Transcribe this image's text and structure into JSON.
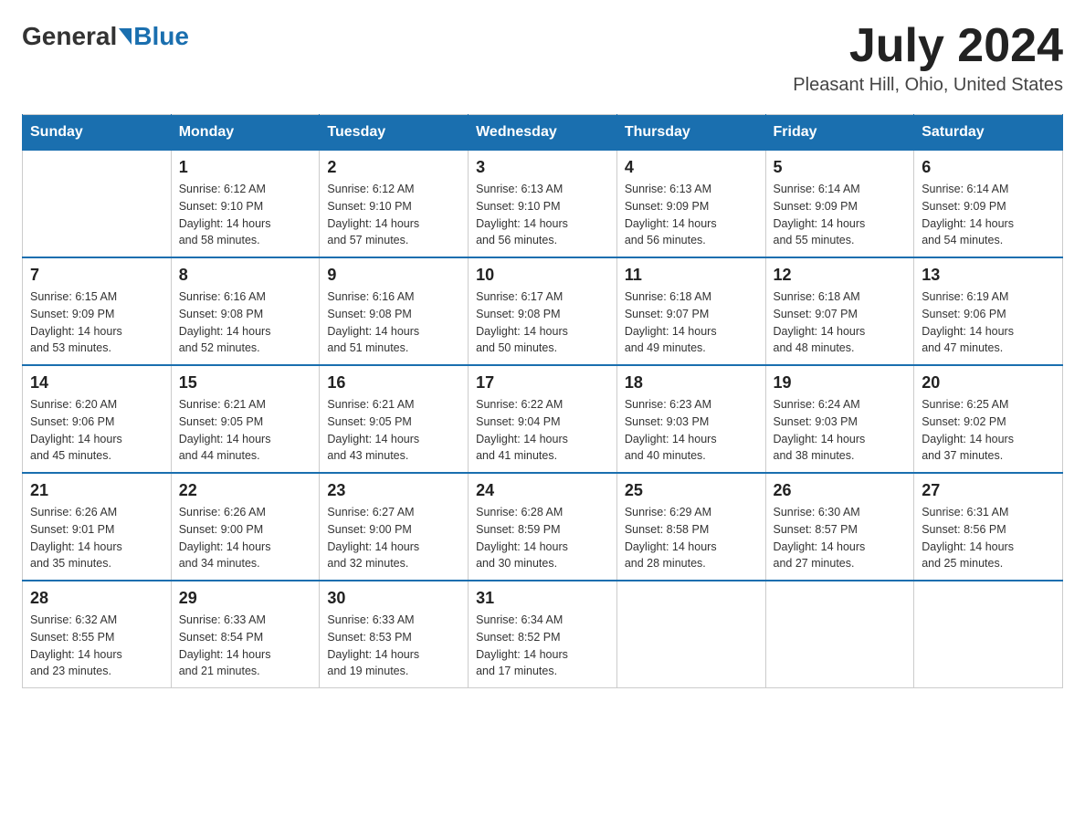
{
  "logo": {
    "general": "General",
    "blue": "Blue"
  },
  "title": "July 2024",
  "location": "Pleasant Hill, Ohio, United States",
  "days_of_week": [
    "Sunday",
    "Monday",
    "Tuesday",
    "Wednesday",
    "Thursday",
    "Friday",
    "Saturday"
  ],
  "weeks": [
    [
      {
        "day": "",
        "info": ""
      },
      {
        "day": "1",
        "info": "Sunrise: 6:12 AM\nSunset: 9:10 PM\nDaylight: 14 hours\nand 58 minutes."
      },
      {
        "day": "2",
        "info": "Sunrise: 6:12 AM\nSunset: 9:10 PM\nDaylight: 14 hours\nand 57 minutes."
      },
      {
        "day": "3",
        "info": "Sunrise: 6:13 AM\nSunset: 9:10 PM\nDaylight: 14 hours\nand 56 minutes."
      },
      {
        "day": "4",
        "info": "Sunrise: 6:13 AM\nSunset: 9:09 PM\nDaylight: 14 hours\nand 56 minutes."
      },
      {
        "day": "5",
        "info": "Sunrise: 6:14 AM\nSunset: 9:09 PM\nDaylight: 14 hours\nand 55 minutes."
      },
      {
        "day": "6",
        "info": "Sunrise: 6:14 AM\nSunset: 9:09 PM\nDaylight: 14 hours\nand 54 minutes."
      }
    ],
    [
      {
        "day": "7",
        "info": "Sunrise: 6:15 AM\nSunset: 9:09 PM\nDaylight: 14 hours\nand 53 minutes."
      },
      {
        "day": "8",
        "info": "Sunrise: 6:16 AM\nSunset: 9:08 PM\nDaylight: 14 hours\nand 52 minutes."
      },
      {
        "day": "9",
        "info": "Sunrise: 6:16 AM\nSunset: 9:08 PM\nDaylight: 14 hours\nand 51 minutes."
      },
      {
        "day": "10",
        "info": "Sunrise: 6:17 AM\nSunset: 9:08 PM\nDaylight: 14 hours\nand 50 minutes."
      },
      {
        "day": "11",
        "info": "Sunrise: 6:18 AM\nSunset: 9:07 PM\nDaylight: 14 hours\nand 49 minutes."
      },
      {
        "day": "12",
        "info": "Sunrise: 6:18 AM\nSunset: 9:07 PM\nDaylight: 14 hours\nand 48 minutes."
      },
      {
        "day": "13",
        "info": "Sunrise: 6:19 AM\nSunset: 9:06 PM\nDaylight: 14 hours\nand 47 minutes."
      }
    ],
    [
      {
        "day": "14",
        "info": "Sunrise: 6:20 AM\nSunset: 9:06 PM\nDaylight: 14 hours\nand 45 minutes."
      },
      {
        "day": "15",
        "info": "Sunrise: 6:21 AM\nSunset: 9:05 PM\nDaylight: 14 hours\nand 44 minutes."
      },
      {
        "day": "16",
        "info": "Sunrise: 6:21 AM\nSunset: 9:05 PM\nDaylight: 14 hours\nand 43 minutes."
      },
      {
        "day": "17",
        "info": "Sunrise: 6:22 AM\nSunset: 9:04 PM\nDaylight: 14 hours\nand 41 minutes."
      },
      {
        "day": "18",
        "info": "Sunrise: 6:23 AM\nSunset: 9:03 PM\nDaylight: 14 hours\nand 40 minutes."
      },
      {
        "day": "19",
        "info": "Sunrise: 6:24 AM\nSunset: 9:03 PM\nDaylight: 14 hours\nand 38 minutes."
      },
      {
        "day": "20",
        "info": "Sunrise: 6:25 AM\nSunset: 9:02 PM\nDaylight: 14 hours\nand 37 minutes."
      }
    ],
    [
      {
        "day": "21",
        "info": "Sunrise: 6:26 AM\nSunset: 9:01 PM\nDaylight: 14 hours\nand 35 minutes."
      },
      {
        "day": "22",
        "info": "Sunrise: 6:26 AM\nSunset: 9:00 PM\nDaylight: 14 hours\nand 34 minutes."
      },
      {
        "day": "23",
        "info": "Sunrise: 6:27 AM\nSunset: 9:00 PM\nDaylight: 14 hours\nand 32 minutes."
      },
      {
        "day": "24",
        "info": "Sunrise: 6:28 AM\nSunset: 8:59 PM\nDaylight: 14 hours\nand 30 minutes."
      },
      {
        "day": "25",
        "info": "Sunrise: 6:29 AM\nSunset: 8:58 PM\nDaylight: 14 hours\nand 28 minutes."
      },
      {
        "day": "26",
        "info": "Sunrise: 6:30 AM\nSunset: 8:57 PM\nDaylight: 14 hours\nand 27 minutes."
      },
      {
        "day": "27",
        "info": "Sunrise: 6:31 AM\nSunset: 8:56 PM\nDaylight: 14 hours\nand 25 minutes."
      }
    ],
    [
      {
        "day": "28",
        "info": "Sunrise: 6:32 AM\nSunset: 8:55 PM\nDaylight: 14 hours\nand 23 minutes."
      },
      {
        "day": "29",
        "info": "Sunrise: 6:33 AM\nSunset: 8:54 PM\nDaylight: 14 hours\nand 21 minutes."
      },
      {
        "day": "30",
        "info": "Sunrise: 6:33 AM\nSunset: 8:53 PM\nDaylight: 14 hours\nand 19 minutes."
      },
      {
        "day": "31",
        "info": "Sunrise: 6:34 AM\nSunset: 8:52 PM\nDaylight: 14 hours\nand 17 minutes."
      },
      {
        "day": "",
        "info": ""
      },
      {
        "day": "",
        "info": ""
      },
      {
        "day": "",
        "info": ""
      }
    ]
  ]
}
